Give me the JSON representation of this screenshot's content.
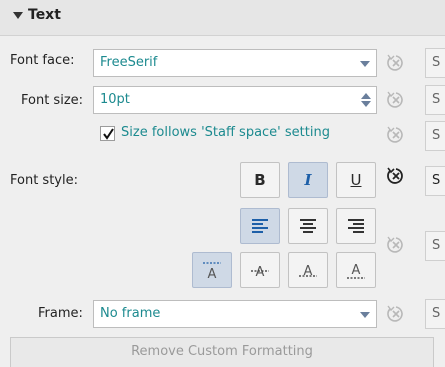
{
  "section": {
    "title": "Text"
  },
  "font_face": {
    "label": "Font face:",
    "value": "FreeSerif"
  },
  "font_size": {
    "label": "Font size:",
    "value": "10pt"
  },
  "size_follows": {
    "label": "Size follows 'Staff space' setting",
    "checked": true
  },
  "font_style": {
    "label": "Font style:"
  },
  "style_buttons": {
    "bold": "B",
    "italic": "I",
    "underline": "U"
  },
  "set_style_label": "S",
  "frame": {
    "label": "Frame:",
    "value": "No frame"
  },
  "remove_button": {
    "label": "Remove Custom Formatting"
  },
  "colors": {
    "accent": "#1c8a8f",
    "toggle_on": "#cfd9e6"
  }
}
